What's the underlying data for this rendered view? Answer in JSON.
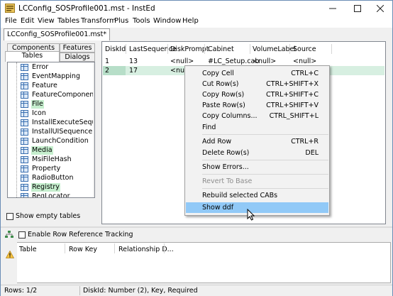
{
  "window": {
    "title": "LCConfig_SOSProfile001.mst - InstEd"
  },
  "menu": [
    "File",
    "Edit",
    "View",
    "Tables",
    "Transform",
    "Plus",
    "Tools",
    "Window",
    "Help"
  ],
  "document_tab": "LCConfig_SOSProfile001.mst*",
  "left_tabs": {
    "components": "Components",
    "features": "Features",
    "tables": "Tables",
    "dialogs": "Dialogs"
  },
  "table_list": [
    {
      "label": "Error",
      "highlight": false
    },
    {
      "label": "EventMapping",
      "highlight": false
    },
    {
      "label": "Feature",
      "highlight": false
    },
    {
      "label": "FeatureComponents",
      "highlight": false
    },
    {
      "label": "File",
      "highlight": true
    },
    {
      "label": "Icon",
      "highlight": false
    },
    {
      "label": "InstallExecuteSequen",
      "highlight": false
    },
    {
      "label": "InstallUISequence",
      "highlight": false
    },
    {
      "label": "LaunchCondition",
      "highlight": false
    },
    {
      "label": "Media",
      "highlight": true
    },
    {
      "label": "MsiFileHash",
      "highlight": false
    },
    {
      "label": "Property",
      "highlight": false
    },
    {
      "label": "RadioButton",
      "highlight": false
    },
    {
      "label": "Registry",
      "highlight": true
    },
    {
      "label": "RegLocator",
      "highlight": false
    }
  ],
  "show_empty_tables": "Show empty tables",
  "grid": {
    "columns": [
      "DiskId",
      "LastSequence",
      "DiskPrompt",
      "Cabinet",
      "VolumeLabel",
      "Source"
    ],
    "rows": [
      [
        "1",
        "13",
        "<null>",
        "#LC_Setup.cab",
        "<null>",
        "<null>"
      ],
      [
        "2",
        "17",
        "<null",
        "",
        "",
        ""
      ]
    ]
  },
  "context_menu": [
    {
      "label": "Copy Cell",
      "shortcut": "CTRL+C",
      "disabled": false
    },
    {
      "label": "Cut Row(s)",
      "shortcut": "CTRL+SHIFT+X",
      "disabled": false
    },
    {
      "label": "Copy Row(s)",
      "shortcut": "CTRL+SHIFT+C",
      "disabled": false
    },
    {
      "label": "Paste Row(s)",
      "shortcut": "CTRL+SHIFT+V",
      "disabled": false
    },
    {
      "label": "Copy Columns...",
      "shortcut": "CTRL_SHIFT+L",
      "disabled": false
    },
    {
      "label": "Find",
      "shortcut": "",
      "disabled": false
    },
    {
      "label": "Add Row",
      "shortcut": "CTRL+R",
      "disabled": false
    },
    {
      "label": "Delete Row(s)",
      "shortcut": "DEL",
      "disabled": false
    },
    {
      "label": "Show  Errors...",
      "shortcut": "",
      "disabled": false
    },
    {
      "label": "Revert To Base",
      "shortcut": "",
      "disabled": true
    },
    {
      "label": "Rebuild selected CABs",
      "shortcut": "",
      "disabled": false
    },
    {
      "label": "Show ddf",
      "shortcut": "",
      "disabled": false,
      "hover": true
    }
  ],
  "enable_row_tracking": "Enable Row Reference Tracking",
  "bottom_grid": {
    "columns": [
      "Table",
      "Row Key",
      "Relationship D..."
    ]
  },
  "status": {
    "rows": "Rows: 1/2",
    "info": "DiskId: Number (2), Key, Required"
  },
  "colors": {
    "highlight_green": "#c6efce",
    "menu_hover": "#91c9f7",
    "selected_row": "#d7efe1"
  }
}
